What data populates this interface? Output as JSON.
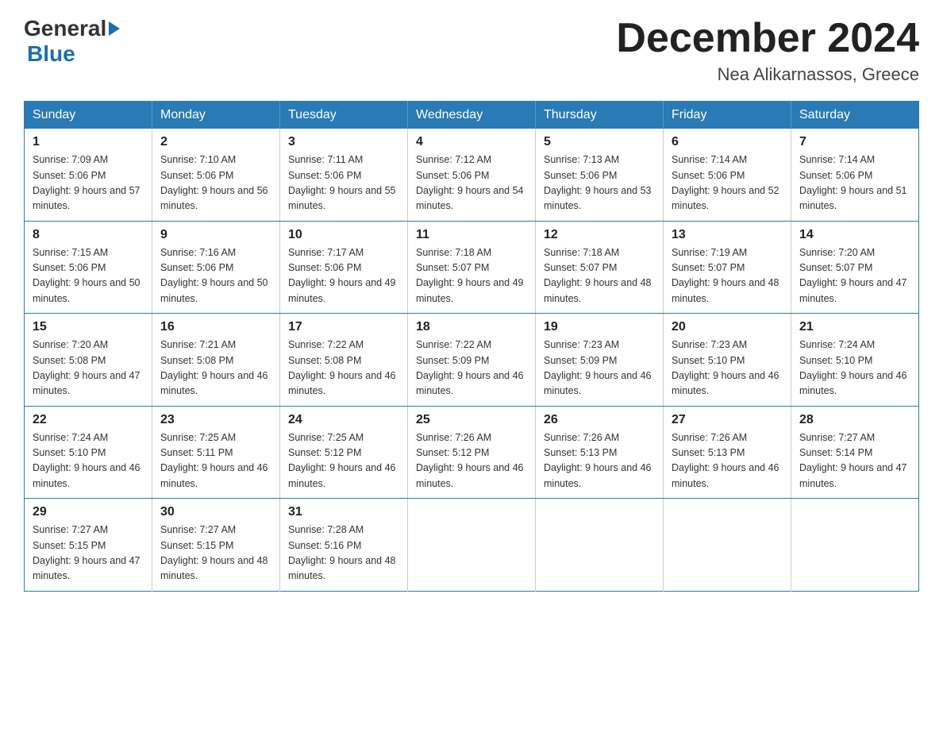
{
  "logo": {
    "general": "General",
    "blue": "Blue"
  },
  "title": {
    "month": "December 2024",
    "location": "Nea Alikarnassos, Greece"
  },
  "headers": [
    "Sunday",
    "Monday",
    "Tuesday",
    "Wednesday",
    "Thursday",
    "Friday",
    "Saturday"
  ],
  "weeks": [
    [
      {
        "day": "1",
        "sunrise": "7:09 AM",
        "sunset": "5:06 PM",
        "daylight": "9 hours and 57 minutes."
      },
      {
        "day": "2",
        "sunrise": "7:10 AM",
        "sunset": "5:06 PM",
        "daylight": "9 hours and 56 minutes."
      },
      {
        "day": "3",
        "sunrise": "7:11 AM",
        "sunset": "5:06 PM",
        "daylight": "9 hours and 55 minutes."
      },
      {
        "day": "4",
        "sunrise": "7:12 AM",
        "sunset": "5:06 PM",
        "daylight": "9 hours and 54 minutes."
      },
      {
        "day": "5",
        "sunrise": "7:13 AM",
        "sunset": "5:06 PM",
        "daylight": "9 hours and 53 minutes."
      },
      {
        "day": "6",
        "sunrise": "7:14 AM",
        "sunset": "5:06 PM",
        "daylight": "9 hours and 52 minutes."
      },
      {
        "day": "7",
        "sunrise": "7:14 AM",
        "sunset": "5:06 PM",
        "daylight": "9 hours and 51 minutes."
      }
    ],
    [
      {
        "day": "8",
        "sunrise": "7:15 AM",
        "sunset": "5:06 PM",
        "daylight": "9 hours and 50 minutes."
      },
      {
        "day": "9",
        "sunrise": "7:16 AM",
        "sunset": "5:06 PM",
        "daylight": "9 hours and 50 minutes."
      },
      {
        "day": "10",
        "sunrise": "7:17 AM",
        "sunset": "5:06 PM",
        "daylight": "9 hours and 49 minutes."
      },
      {
        "day": "11",
        "sunrise": "7:18 AM",
        "sunset": "5:07 PM",
        "daylight": "9 hours and 49 minutes."
      },
      {
        "day": "12",
        "sunrise": "7:18 AM",
        "sunset": "5:07 PM",
        "daylight": "9 hours and 48 minutes."
      },
      {
        "day": "13",
        "sunrise": "7:19 AM",
        "sunset": "5:07 PM",
        "daylight": "9 hours and 48 minutes."
      },
      {
        "day": "14",
        "sunrise": "7:20 AM",
        "sunset": "5:07 PM",
        "daylight": "9 hours and 47 minutes."
      }
    ],
    [
      {
        "day": "15",
        "sunrise": "7:20 AM",
        "sunset": "5:08 PM",
        "daylight": "9 hours and 47 minutes."
      },
      {
        "day": "16",
        "sunrise": "7:21 AM",
        "sunset": "5:08 PM",
        "daylight": "9 hours and 46 minutes."
      },
      {
        "day": "17",
        "sunrise": "7:22 AM",
        "sunset": "5:08 PM",
        "daylight": "9 hours and 46 minutes."
      },
      {
        "day": "18",
        "sunrise": "7:22 AM",
        "sunset": "5:09 PM",
        "daylight": "9 hours and 46 minutes."
      },
      {
        "day": "19",
        "sunrise": "7:23 AM",
        "sunset": "5:09 PM",
        "daylight": "9 hours and 46 minutes."
      },
      {
        "day": "20",
        "sunrise": "7:23 AM",
        "sunset": "5:10 PM",
        "daylight": "9 hours and 46 minutes."
      },
      {
        "day": "21",
        "sunrise": "7:24 AM",
        "sunset": "5:10 PM",
        "daylight": "9 hours and 46 minutes."
      }
    ],
    [
      {
        "day": "22",
        "sunrise": "7:24 AM",
        "sunset": "5:10 PM",
        "daylight": "9 hours and 46 minutes."
      },
      {
        "day": "23",
        "sunrise": "7:25 AM",
        "sunset": "5:11 PM",
        "daylight": "9 hours and 46 minutes."
      },
      {
        "day": "24",
        "sunrise": "7:25 AM",
        "sunset": "5:12 PM",
        "daylight": "9 hours and 46 minutes."
      },
      {
        "day": "25",
        "sunrise": "7:26 AM",
        "sunset": "5:12 PM",
        "daylight": "9 hours and 46 minutes."
      },
      {
        "day": "26",
        "sunrise": "7:26 AM",
        "sunset": "5:13 PM",
        "daylight": "9 hours and 46 minutes."
      },
      {
        "day": "27",
        "sunrise": "7:26 AM",
        "sunset": "5:13 PM",
        "daylight": "9 hours and 46 minutes."
      },
      {
        "day": "28",
        "sunrise": "7:27 AM",
        "sunset": "5:14 PM",
        "daylight": "9 hours and 47 minutes."
      }
    ],
    [
      {
        "day": "29",
        "sunrise": "7:27 AM",
        "sunset": "5:15 PM",
        "daylight": "9 hours and 47 minutes."
      },
      {
        "day": "30",
        "sunrise": "7:27 AM",
        "sunset": "5:15 PM",
        "daylight": "9 hours and 48 minutes."
      },
      {
        "day": "31",
        "sunrise": "7:28 AM",
        "sunset": "5:16 PM",
        "daylight": "9 hours and 48 minutes."
      },
      null,
      null,
      null,
      null
    ]
  ]
}
